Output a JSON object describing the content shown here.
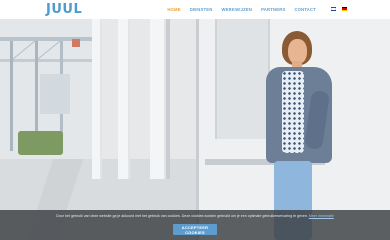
{
  "header": {
    "logo_text": "JUUL",
    "nav": [
      {
        "label": "Home",
        "active": true
      },
      {
        "label": "Diensten",
        "active": false
      },
      {
        "label": "Werkwijzen",
        "active": false
      },
      {
        "label": "Partners",
        "active": false
      },
      {
        "label": "Contact",
        "active": false
      }
    ],
    "languages": [
      {
        "code": "nl",
        "icon": "flag-nl-icon"
      },
      {
        "code": "de",
        "icon": "flag-de-icon"
      }
    ]
  },
  "hero": {
    "image": "woman-leaning-against-wall-photo"
  },
  "cookie_banner": {
    "text": "Door het gebruik van deze website ga je akkoord met het gebruik van cookies. Deze cookies worden gebruikt om je een optimale gebruikerservaring te geven.",
    "more_link": "Meer informatie",
    "accept_label": "Accepteer cookies"
  },
  "colors": {
    "brand_blue": "#5e9fcf",
    "active_orange": "#e9a23b",
    "banner_bg": "#3a3e42",
    "button_bg": "#5d9ccf"
  }
}
